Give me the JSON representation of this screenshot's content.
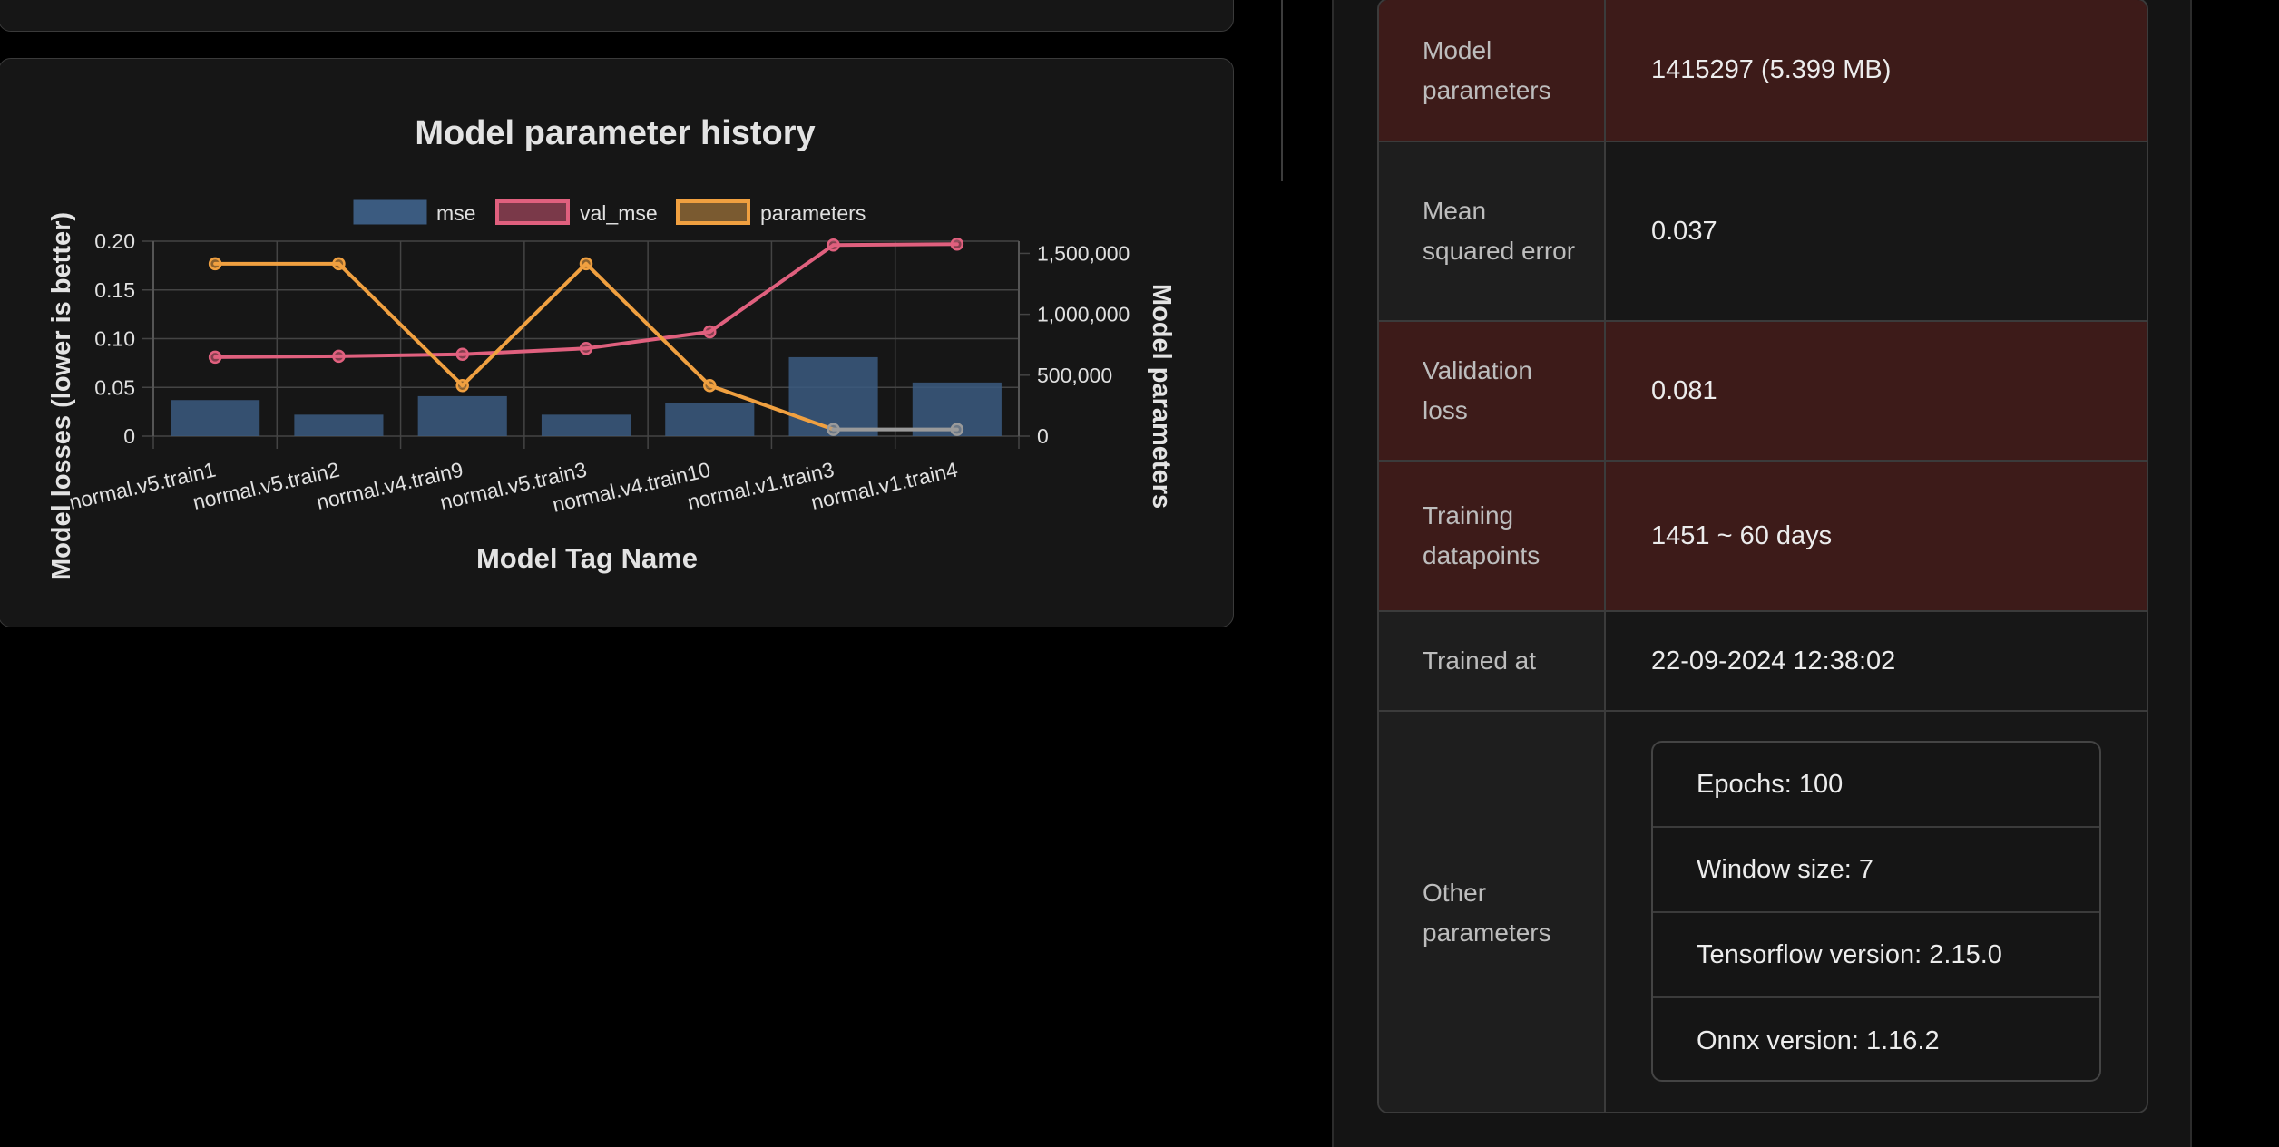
{
  "chart_card": {
    "chart_data": {
      "type": "bar",
      "title": "Model parameter history",
      "xlabel": "Model Tag Name",
      "ylabel": "Model losses (lower is better)",
      "y2label": "Model parameters",
      "categories": [
        "normal.v5.train1",
        "normal.v5.train2",
        "normal.v4.train9",
        "normal.v5.train3",
        "normal.v4.train10",
        "normal.v1.train3",
        "normal.v1.train4"
      ],
      "y_ticks": [
        "0.20",
        "0.15",
        "0.10",
        "0.05",
        "0"
      ],
      "y2_ticks": [
        "1,500,000",
        "1,000,000",
        "500,000",
        "0"
      ],
      "ylim": [
        0,
        0.2
      ],
      "y2lim": [
        0,
        1600000
      ],
      "grid": true,
      "legend_position": "top",
      "series": [
        {
          "name": "mse",
          "type": "bar",
          "axis": "left",
          "color": "#3b5b80",
          "values": [
            0.037,
            0.022,
            0.041,
            0.022,
            0.034,
            0.081,
            0.055
          ]
        },
        {
          "name": "val_mse",
          "type": "line",
          "axis": "left",
          "color": "#e0607e",
          "values": [
            0.081,
            0.082,
            0.084,
            0.09,
            0.107,
            0.196,
            0.197
          ]
        },
        {
          "name": "parameters",
          "type": "line",
          "axis": "right",
          "color": "#f0a040",
          "values": [
            1415297,
            1415297,
            415297,
            1415297,
            415297,
            55000,
            55000
          ]
        }
      ]
    }
  },
  "info_table": {
    "rows": [
      {
        "label": "Model parameters",
        "value": "1415297 (5.399 MB)"
      },
      {
        "label": "Mean squared error",
        "value": "0.037"
      },
      {
        "label": "Validation loss",
        "value": "0.081"
      },
      {
        "label": "Training datapoints",
        "value": "1451 ~ 60 days"
      },
      {
        "label": "Trained at",
        "value": "22-09-2024 12:38:02"
      },
      {
        "label": "Other parameters",
        "items": [
          "Epochs: 100",
          "Window size: 7",
          "Tensorflow version: 2.15.0",
          "Onnx version: 1.16.2"
        ]
      }
    ]
  },
  "colors": {
    "warn_row": "#3d1b19",
    "plain_row": "#171717",
    "page_bg": "#000000"
  }
}
